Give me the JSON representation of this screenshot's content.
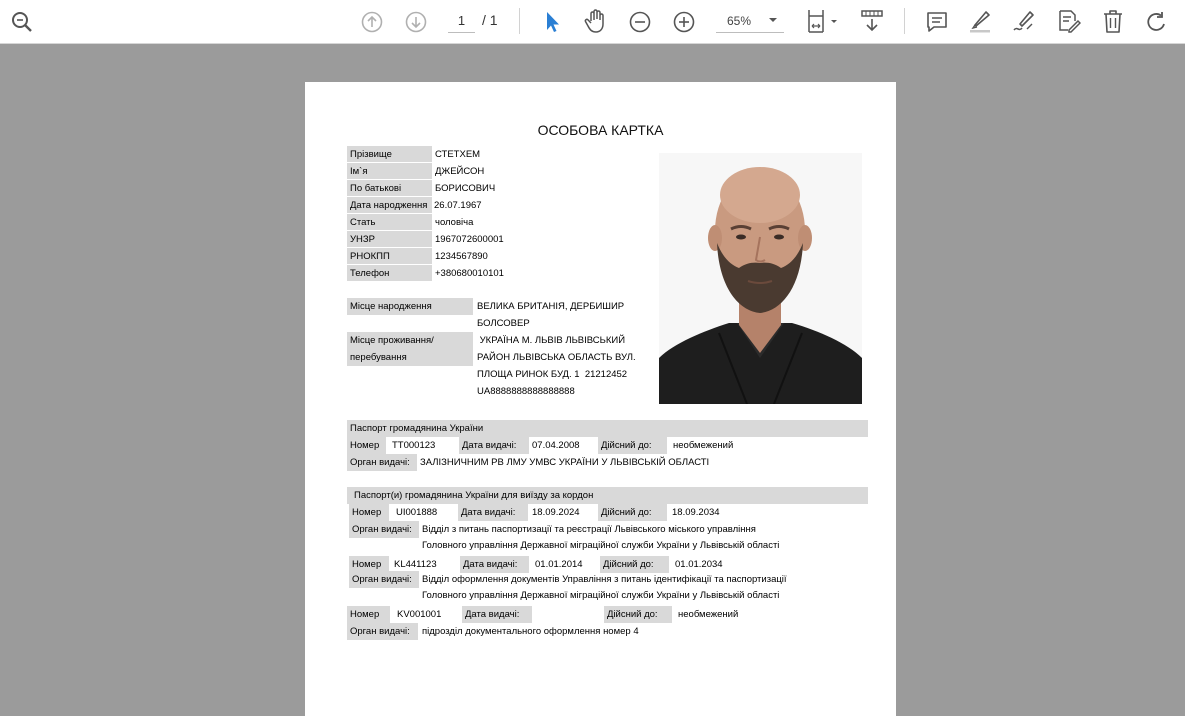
{
  "toolbar": {
    "page_current": "1",
    "page_total": "/ 1",
    "zoom": "65%",
    "icons": [
      "zoom-search-icon",
      "prev-page-icon",
      "next-page-icon",
      "select-cursor-icon",
      "hand-icon",
      "zoom-out-icon",
      "zoom-in-icon",
      "fit-page-icon",
      "download-icon",
      "comment-icon",
      "highlight-icon",
      "draw-icon",
      "edit-text-icon",
      "delete-icon",
      "rotate-icon"
    ]
  },
  "document": {
    "title": "ОСОБОВА КАРТКА",
    "personal": [
      {
        "label": "Прізвище",
        "value": "СТЕТХЕМ"
      },
      {
        "label": "Ім`я",
        "value": "ДЖЕЙСОН"
      },
      {
        "label": "По батькові",
        "value": "БОРИСОВИЧ"
      },
      {
        "label": "Дата народження",
        "value": "26.07.1967"
      },
      {
        "label": "Стать",
        "value": "чоловіча"
      },
      {
        "label": "УНЗР",
        "value": "1967072600001"
      },
      {
        "label": "РНОКПП",
        "value": "1234567890"
      },
      {
        "label": "Телефон",
        "value": "+380680010101"
      }
    ],
    "birthplace": {
      "label": "Місце народження",
      "line1": "ВЕЛИКА БРИТАНІЯ, ДЕРБИШИР",
      "line2": "БОЛСОВЕР"
    },
    "residence": {
      "label1": "Місце проживання/",
      "label2": "перебування",
      "line1": " УКРАЇНА М. ЛЬВІВ ЛЬВІВСЬКИЙ",
      "line2": "РАЙОН ЛЬВІВСЬКА ОБЛАСТЬ ВУЛ.",
      "line3": "ПЛОЩА РИНОК БУД. 1  21212452",
      "line4": "UA8888888888888888"
    },
    "passport": {
      "header": "Паспорт громадянина України",
      "number_label": "Номер",
      "number": "ТТ000123",
      "issued_label": "Дата видачі:",
      "issued": "07.04.2008",
      "valid_label": "Дійсний до:",
      "valid": "необмежений",
      "org_label": "Орган видачі:",
      "org": "ЗАЛІЗНИЧНИМ РВ ЛМУ УМВС УКРАЇНИ У ЛЬВІВСЬКІЙ ОБЛАСТІ"
    },
    "foreign": {
      "header": "Паспорт(и) громадянина України для виїзду за кордон",
      "items": [
        {
          "number_label": "Номер",
          "number": "UI001888",
          "issued_label": "Дата видачі:",
          "issued": "18.09.2024",
          "valid_label": "Дійсний до:",
          "valid": "18.09.2034",
          "org_label": "Орган видачі:",
          "org1": "Відділ з питань паспортизації та реєстрації Львівського міського управління",
          "org2": "Головного управління Державної міграційної служби України у Львівській області"
        },
        {
          "number_label": "Номер",
          "number": "KL441123",
          "issued_label": "Дата видачі:",
          "issued": "01.01.2014",
          "valid_label": "Дійсний до:",
          "valid": "01.01.2034",
          "org_label": "Орган видачі:",
          "org1": "Відділ оформлення документів Управління з питань ідентифікації та паспортизації",
          "org2": "Головного управління Державної міграційної служби України у Львівській області"
        },
        {
          "number_label": "Номер",
          "number": "KV001001",
          "issued_label": "Дата видачі:",
          "issued": "",
          "valid_label": "Дійсний до:",
          "valid": "необмежений",
          "org_label": "Орган видачі:",
          "org1": "підрозділ документального оформлення номер 4"
        }
      ]
    }
  },
  "colors": {
    "toolbar_bg": "#ffffff",
    "workspace_bg": "#9b9b9b",
    "accent": "#2a7fd4",
    "label_bg": "#d9d9d9"
  }
}
